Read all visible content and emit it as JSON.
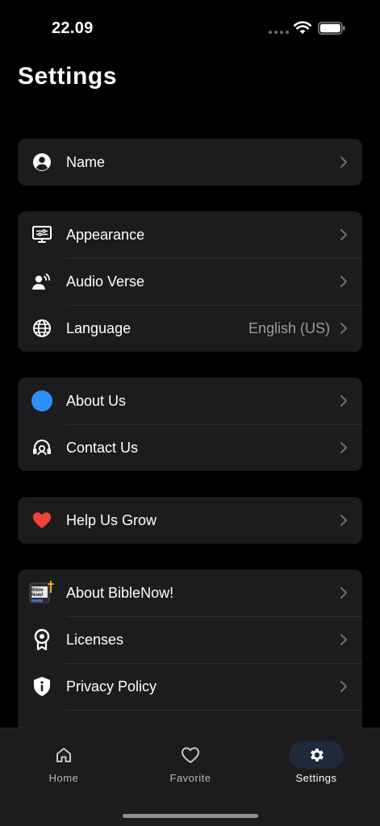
{
  "status_bar": {
    "time": "22.09",
    "wifi_icon": "wifi-icon",
    "battery_icon": "battery-icon"
  },
  "page": {
    "title": "Settings"
  },
  "groups": [
    {
      "items": [
        {
          "label": "Name",
          "icon": "person-circle-icon",
          "value": ""
        }
      ]
    },
    {
      "items": [
        {
          "label": "Appearance",
          "icon": "monitor-settings-icon",
          "value": ""
        },
        {
          "label": "Audio Verse",
          "icon": "voice-person-icon",
          "value": ""
        },
        {
          "label": "Language",
          "icon": "globe-icon",
          "value": "English (US)"
        }
      ]
    },
    {
      "items": [
        {
          "label": "About Us",
          "icon": "blue-circle-icon",
          "value": ""
        },
        {
          "label": "Contact Us",
          "icon": "headset-icon",
          "value": ""
        }
      ]
    },
    {
      "items": [
        {
          "label": "Help Us Grow",
          "icon": "heart-icon",
          "value": ""
        }
      ]
    },
    {
      "items": [
        {
          "label": "About BibleNow!",
          "icon": "biblenow-logo-icon",
          "value": "",
          "logo_text": "Bible Now!"
        },
        {
          "label": "Licenses",
          "icon": "award-ribbon-icon",
          "value": ""
        },
        {
          "label": "Privacy Policy",
          "icon": "shield-info-icon",
          "value": ""
        }
      ]
    }
  ],
  "bottom_nav": {
    "items": [
      {
        "label": "Home",
        "icon": "home-icon",
        "active": false
      },
      {
        "label": "Favorite",
        "icon": "heart-outline-icon",
        "active": false
      },
      {
        "label": "Settings",
        "icon": "gear-icon",
        "active": true
      }
    ]
  },
  "colors": {
    "background": "#000000",
    "card": "#1c1c1e",
    "accent_blue": "#2e8ff5",
    "heart_red": "#f0443a",
    "secondary_text": "#9a9a9e"
  }
}
